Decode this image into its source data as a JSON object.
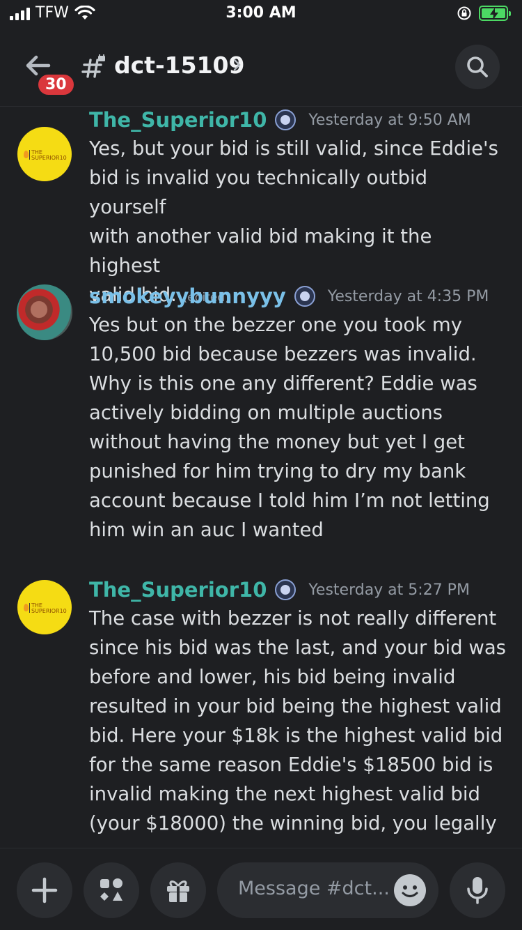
{
  "status_bar": {
    "carrier": "TFW",
    "time": "3:00 AM"
  },
  "header": {
    "back_badge": "30",
    "channel_name": "dct-15109"
  },
  "messages": [
    {
      "author": "The_Superior10",
      "avatar_text": [
        "THE",
        "SUPERIOR10"
      ],
      "timestamp": "Yesterday at 9:50 AM",
      "lines": [
        "Yes, but your bid is still valid, since Eddie's",
        "bid is invalid you technically outbid yourself",
        "with another valid bid making it the highest",
        "valid bid."
      ],
      "edited_label": "(edited)"
    },
    {
      "author": "smokeyybunnyyy",
      "timestamp": "Yesterday at 4:35 PM",
      "lines": [
        "Yes but on the bezzer one you took my",
        "10,500 bid because bezzers was invalid.",
        "Why is this one any different? Eddie was",
        "actively bidding on multiple auctions",
        "without having the money but yet I get",
        "punished for him trying to dry my bank",
        "account because I told him I’m not letting",
        "him win an auc I wanted"
      ]
    },
    {
      "author": "The_Superior10",
      "avatar_text": [
        "THE",
        "SUPERIOR10"
      ],
      "timestamp": "Yesterday at 5:27 PM",
      "lines": [
        "The case with bezzer is not really different",
        "since his bid was the last, and your bid was",
        "before and lower, his bid being invalid",
        "resulted in your bid being the highest valid",
        "bid. Here your $18k is the highest valid bid",
        "for the same reason Eddie's $18500 bid is",
        "invalid making the next highest valid bid",
        "(your $18000) the winning bid, you legally"
      ]
    }
  ],
  "composer": {
    "placeholder": "Message #dct..."
  }
}
